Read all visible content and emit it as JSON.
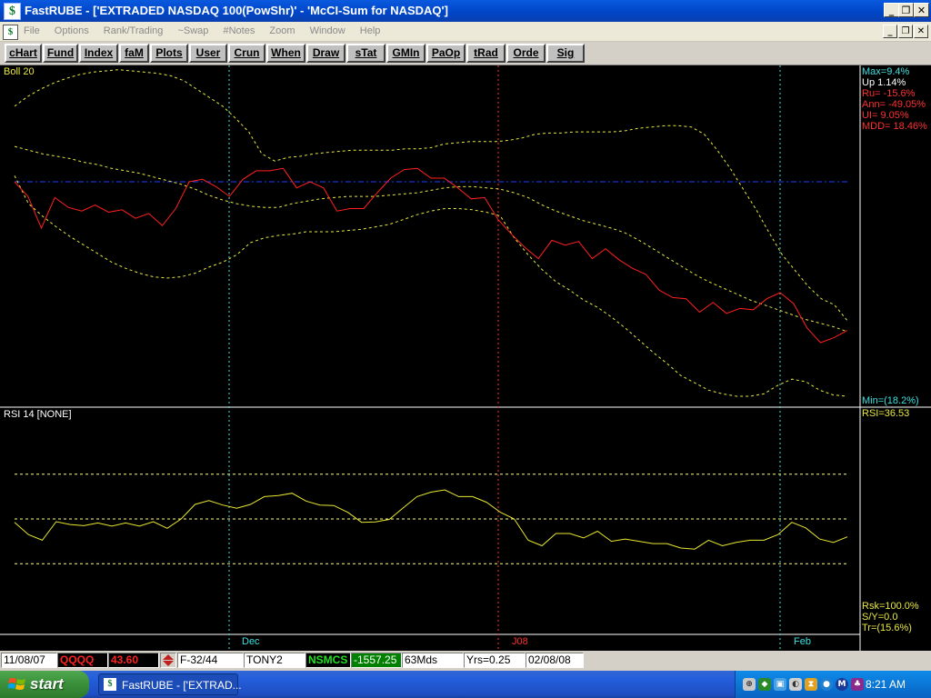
{
  "window": {
    "title": "FastRUBE - ['EXTRADED NASDAQ 100(PowShr)' - 'McCI-Sum for NASDAQ']",
    "icon": "dollar-app-icon"
  },
  "menu": {
    "items": [
      "File",
      "Options",
      "Rank/Trading",
      "~Swap",
      "#Notes",
      "Zoom",
      "Window",
      "Help"
    ]
  },
  "toolbar": {
    "buttons": [
      "cHart",
      "Fund",
      "Index",
      "faM",
      "Plots",
      "User",
      "Crun",
      "When",
      "Draw",
      "sTat",
      "GMIn",
      "PaOp",
      "tRad",
      "Orde",
      "Sig"
    ]
  },
  "chart_data": [
    {
      "type": "line",
      "title": "Boll 20",
      "panel": "price",
      "series": [
        {
          "name": "price",
          "color": "#ff2020",
          "values": [
            0.0,
            -1.2,
            -3.8,
            -1.3,
            -2.1,
            -2.4,
            -1.9,
            -2.5,
            -2.3,
            -3.0,
            -2.6,
            -3.6,
            -2.2,
            0.0,
            0.2,
            -0.4,
            -1.2,
            0.2,
            0.9,
            0.9,
            1.1,
            -0.5,
            0.0,
            -0.5,
            -2.4,
            -2.2,
            -2.2,
            -0.9,
            0.3,
            1.0,
            1.1,
            0.3,
            0.3,
            -0.5,
            -1.4,
            -1.3,
            -3.1,
            -4.3,
            -5.4,
            -6.3,
            -4.8,
            -5.2,
            -4.9,
            -6.3,
            -5.5,
            -6.4,
            -7.1,
            -7.6,
            -8.9,
            -9.5,
            -9.6,
            -10.7,
            -9.9,
            -10.8,
            -10.4,
            -10.5,
            -9.6,
            -9.1,
            -10.0,
            -12.0,
            -13.2,
            -12.8,
            -12.2
          ]
        },
        {
          "name": "upper band",
          "color": "#e8e840",
          "values": [
            6.2,
            7.0,
            7.6,
            8.1,
            8.5,
            8.8,
            9.0,
            9.1,
            9.2,
            9.1,
            9.0,
            8.9,
            8.7,
            8.3,
            7.6,
            6.9,
            6.2,
            5.2,
            4.1,
            2.3,
            1.7,
            2.0,
            2.1,
            2.3,
            2.4,
            2.5,
            2.6,
            2.6,
            2.6,
            2.6,
            2.7,
            2.7,
            2.8,
            3.1,
            3.2,
            3.3,
            3.3,
            3.3,
            3.4,
            3.6,
            3.9,
            4.0,
            4.0,
            4.1,
            4.1,
            4.1,
            4.1,
            4.2,
            4.4,
            4.5,
            4.6,
            4.6,
            4.5,
            3.9,
            2.6,
            1.1,
            -0.6,
            -2.3,
            -4.2,
            -6.0,
            -7.3,
            -8.6,
            -9.6,
            -10.1,
            -11.4
          ]
        },
        {
          "name": "middle band",
          "color": "#e8e840",
          "values": [
            2.9,
            2.6,
            2.3,
            2.1,
            1.9,
            1.6,
            1.4,
            1.1,
            0.9,
            0.7,
            0.4,
            0.1,
            -0.2,
            -0.6,
            -1.1,
            -1.5,
            -1.8,
            -2.0,
            -2.1,
            -2.1,
            -1.8,
            -1.6,
            -1.4,
            -1.3,
            -1.2,
            -1.2,
            -1.2,
            -1.1,
            -1.0,
            -0.9,
            -0.7,
            -0.5,
            -0.4,
            -0.4,
            -0.5,
            -0.6,
            -0.9,
            -1.3,
            -1.9,
            -2.4,
            -2.8,
            -3.2,
            -3.5,
            -3.8,
            -4.2,
            -4.8,
            -5.5,
            -6.2,
            -6.9,
            -7.6,
            -8.2,
            -8.7,
            -9.2,
            -9.7,
            -10.1,
            -10.5,
            -10.9,
            -11.3,
            -11.6,
            -11.9,
            -12.3
          ]
        },
        {
          "name": "lower band",
          "color": "#e8e840",
          "values": [
            0.5,
            -1.8,
            -2.8,
            -3.7,
            -4.5,
            -5.2,
            -5.9,
            -6.6,
            -7.1,
            -7.5,
            -7.8,
            -7.9,
            -7.8,
            -7.5,
            -7.0,
            -6.6,
            -6.0,
            -5.0,
            -4.6,
            -4.4,
            -4.3,
            -4.1,
            -4.1,
            -4.1,
            -4.0,
            -3.9,
            -3.7,
            -3.5,
            -3.1,
            -2.7,
            -2.4,
            -2.2,
            -2.2,
            -2.3,
            -2.5,
            -2.8,
            -4.6,
            -6.0,
            -7.2,
            -8.2,
            -8.9,
            -9.7,
            -10.3,
            -11.1,
            -12.0,
            -13.0,
            -14.0,
            -14.9,
            -15.9,
            -16.5,
            -17.1,
            -17.4,
            -17.6,
            -17.6,
            -17.4,
            -16.7,
            -16.2,
            -16.4,
            -17.1,
            -17.5,
            -17.6
          ]
        },
        {
          "name": "reference",
          "color": "#2040ff",
          "values": [
            0.0,
            0.0
          ]
        }
      ],
      "events": [
        "Dec",
        "J08",
        "Feb"
      ],
      "stats": {
        "max": "Max=9.4%",
        "up": "Up 1.14%",
        "ru": "Ru= -15.6%",
        "ann": "Ann= -49.05%",
        "ui": "UI= 9.05%",
        "mdd": "MDD= 18.46%",
        "min": "Min=(18.2%)"
      },
      "ylim": [
        -18.2,
        9.4
      ]
    },
    {
      "type": "line",
      "title": "RSI 14 [NONE]",
      "panel": "rsi",
      "series": [
        {
          "name": "RSI",
          "color": "#e8e830",
          "values": [
            48.5,
            43.0,
            40.5,
            48.8,
            47.5,
            47.0,
            48.2,
            46.8,
            48.2,
            46.8,
            48.8,
            45.8,
            50.0,
            56.5,
            58.2,
            56.2,
            54.8,
            56.5,
            60.0,
            60.5,
            61.5,
            58.0,
            56.2,
            56.0,
            53.0,
            48.5,
            48.7,
            49.8,
            55.0,
            60.0,
            62.0,
            63.0,
            60.0,
            60.0,
            57.5,
            53.0,
            50.0,
            40.5,
            38.0,
            43.5,
            43.5,
            41.5,
            44.5,
            40.0,
            41.0,
            40.0,
            39.0,
            39.0,
            37.0,
            36.5,
            40.5,
            38.0,
            39.5,
            40.5,
            40.5,
            43.0,
            48.5,
            46.0,
            41.0,
            39.5,
            42.0
          ]
        }
      ],
      "ref_levels": [
        70,
        50,
        30
      ],
      "stats": {
        "rsi": "RSI=36.53",
        "rsk": "Rsk=100.0%",
        "sy": "S/Y=0.0",
        "tr": "Tr=(15.6%)"
      },
      "ylim": [
        0,
        100
      ]
    }
  ],
  "status": {
    "start_date": "11/08/07",
    "ticker": "QQQQ",
    "price": "43.60",
    "filter": "F-32/44",
    "user": "TONY2",
    "model": "NSMCS",
    "value": "-1557.25",
    "period": "63Mds",
    "years": "Yrs=0.25",
    "end_date": "02/08/08"
  },
  "taskbar": {
    "start_label": "start",
    "task_label": "FastRUBE - ['EXTRAD...",
    "clock": "8:21 AM"
  }
}
